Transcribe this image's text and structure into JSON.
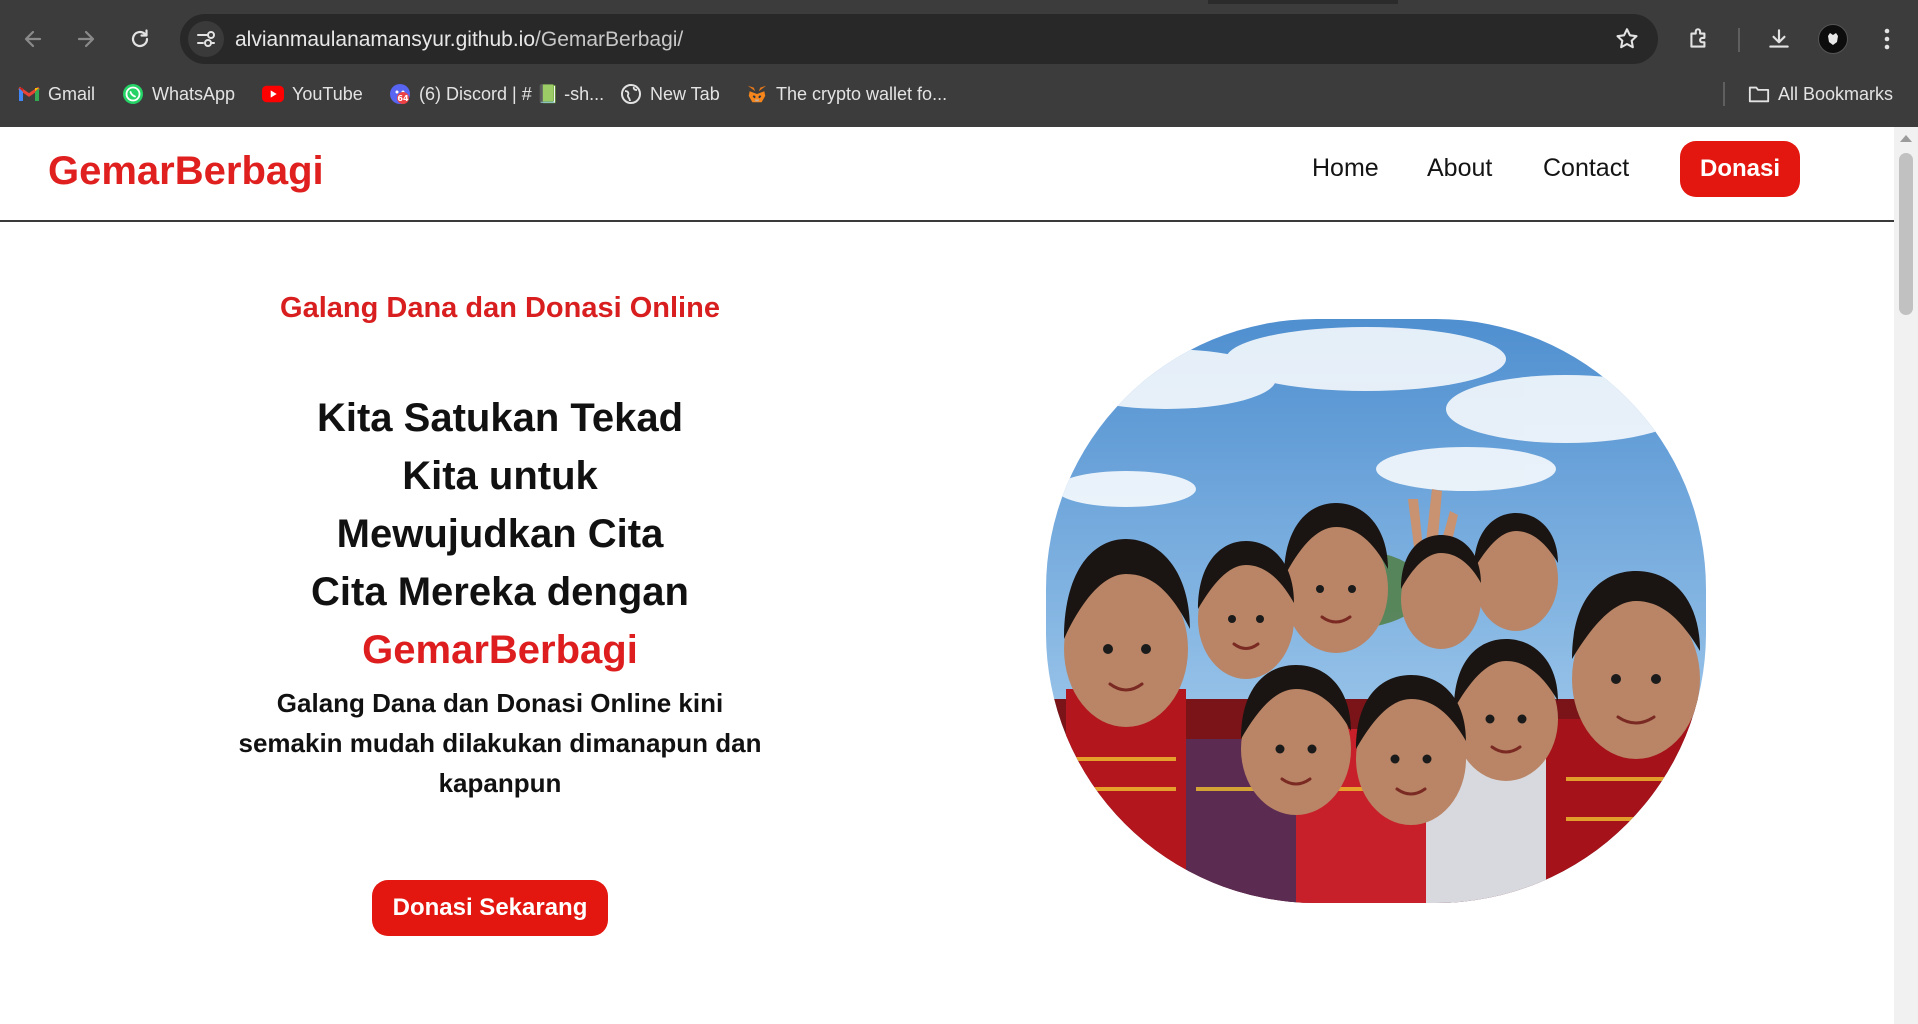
{
  "browser": {
    "url_domain": "alvianmaulanamansyur.github.io",
    "url_path": "/GemarBerbagi/",
    "bookmarks": [
      {
        "label": "Gmail",
        "icon": "gmail-icon"
      },
      {
        "label": "WhatsApp",
        "icon": "whatsapp-icon"
      },
      {
        "label": "YouTube",
        "icon": "youtube-icon"
      },
      {
        "label": "(6) Discord | # 📗 -sh...",
        "icon": "discord-icon",
        "badge": "64"
      },
      {
        "label": "New Tab",
        "icon": "globe-icon"
      },
      {
        "label": "The crypto wallet fo...",
        "icon": "metamask-icon"
      }
    ],
    "all_bookmarks_label": "All Bookmarks"
  },
  "site": {
    "logo": "GemarBerbagi",
    "nav": {
      "home": "Home",
      "about": "About",
      "contact": "Contact",
      "donate": "Donasi"
    }
  },
  "hero": {
    "eyebrow": "Galang Dana dan Donasi Online",
    "headline": "Kita Satukan Tekad Kita untuk Mewujudkan Cita Cita Mereka dengan",
    "headline_brand": "GemarBerbagi",
    "subtext": "Galang Dana dan Donasi Online kini semakin mudah dilakukan dimanapun dan kapanpun",
    "cta": "Donasi Sekarang",
    "image": "group-of-smiling-children-photo"
  },
  "colors": {
    "accent": "#e3170f",
    "chrome_bg": "#3c3c3c",
    "omnibox_bg": "#282828"
  }
}
